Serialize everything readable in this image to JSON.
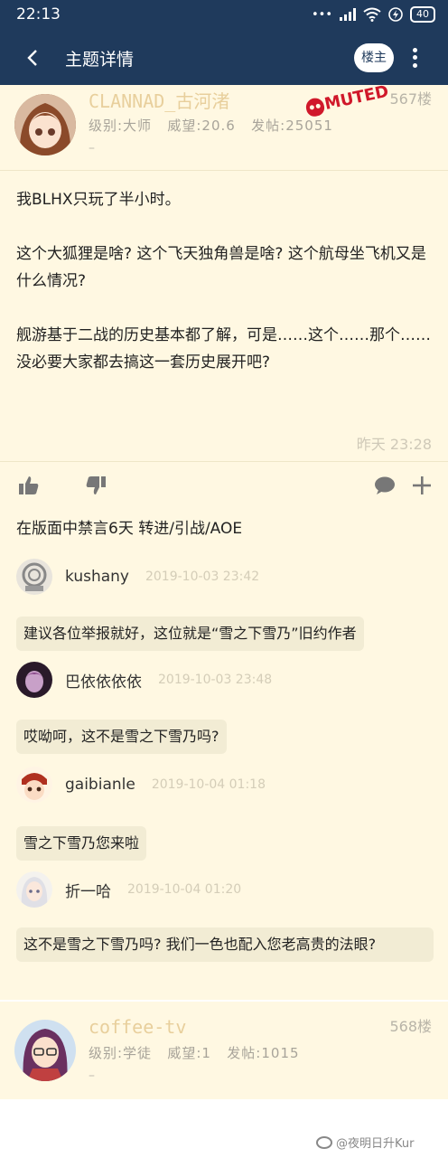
{
  "status_bar": {
    "time": "22:13",
    "icons": "... ıll",
    "battery": "40"
  },
  "nav": {
    "back_icon": "chevron-left",
    "title": "主题详情",
    "op_button": "楼主",
    "more_icon": "more-vertical"
  },
  "post1": {
    "username": "CLANNAD_古河渚",
    "stamp": "MUTED",
    "floor": "567楼",
    "level": "级别:大师",
    "prestige": "威望:20.6",
    "posts": "发帖:25051",
    "dash": "–",
    "content": [
      "我BLHX只玩了半小时。",
      "这个大狐狸是啥? 这个飞天独角兽是啥? 这个航母坐飞机又是什么情况?",
      "舰游基于二战的历史基本都了解，可是……这个……那个……没必要大家都去搞这一套历史展开吧?"
    ],
    "time": "昨天 23:28",
    "ban_notice": "在版面中禁言6天 转进/引战/AOE"
  },
  "replies": [
    {
      "name": "kushany",
      "time": "2019-10-03 23:42",
      "text": "建议各位举报就好，这位就是“雪之下雪乃”旧约作者"
    },
    {
      "name": "巴依依依依",
      "time": "2019-10-03 23:48",
      "text": "哎呦呵，这不是雪之下雪乃吗?"
    },
    {
      "name": "gaibianle",
      "time": "2019-10-04 01:18",
      "text": "雪之下雪乃您来啦"
    },
    {
      "name": "折一哈",
      "time": "2019-10-04 01:20",
      "text": "这不是雪之下雪乃吗? 我们一色也配入您老高贵的法眼?"
    }
  ],
  "post2": {
    "username": "coffee-tv",
    "floor": "568楼",
    "level": "级别:学徒",
    "prestige": "威望:1",
    "posts": "发帖:1015",
    "dash": "–"
  },
  "watermark": "@夜明日升Kur"
}
